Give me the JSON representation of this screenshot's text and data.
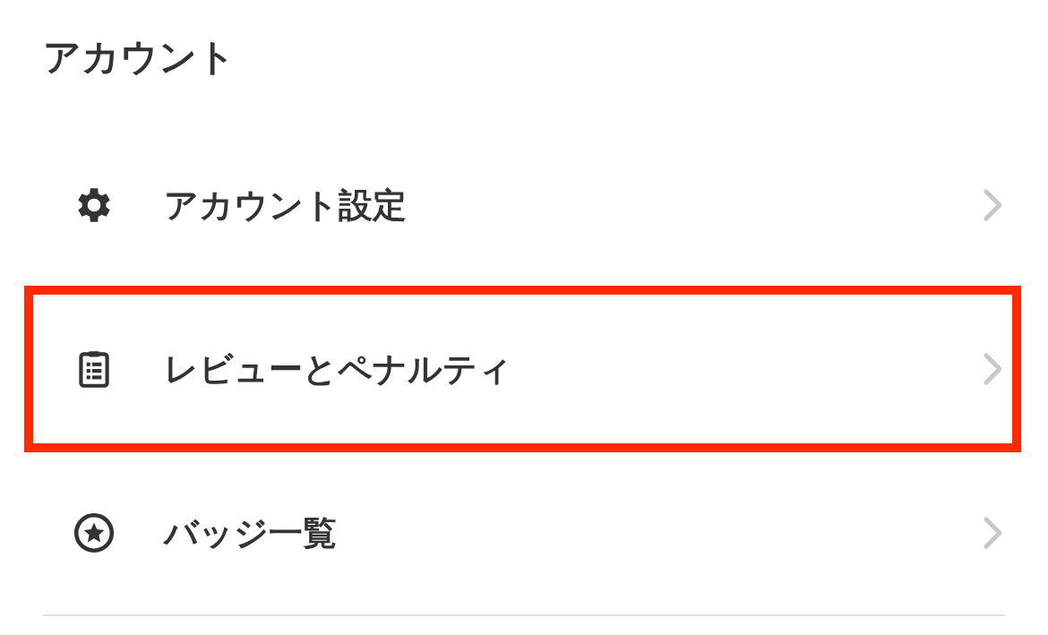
{
  "section": {
    "title": "アカウント"
  },
  "items": [
    {
      "label": "アカウント設定",
      "highlighted": false
    },
    {
      "label": "レビューとペナルティ",
      "highlighted": true
    },
    {
      "label": "バッジ一覧",
      "highlighted": false
    }
  ]
}
